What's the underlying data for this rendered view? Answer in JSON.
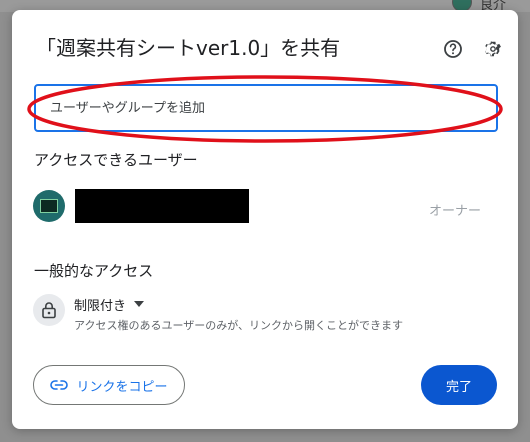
{
  "background": {
    "user_name": "良介"
  },
  "dialog": {
    "title": "「週案共有シートver1.0」を共有",
    "add_people_placeholder": "ユーザーやグループを追加",
    "access_users_heading": "アクセスできるユーザー",
    "owner_role": "オーナー",
    "general_access_heading": "一般的なアクセス",
    "restricted_label": "制限付き",
    "restricted_description": "アクセス権のあるユーザーのみが、リンクから開くことができます",
    "copy_link_label": "リンクをコピー",
    "done_label": "完了"
  },
  "icons": {
    "help": "help-icon",
    "settings": "gear-icon",
    "lock": "lock-icon",
    "dropdown": "triangle-down-icon",
    "link": "link-icon"
  },
  "colors": {
    "accent": "#1a73e8",
    "primary_button": "#0b57d0",
    "annotation": "#e0101a"
  }
}
